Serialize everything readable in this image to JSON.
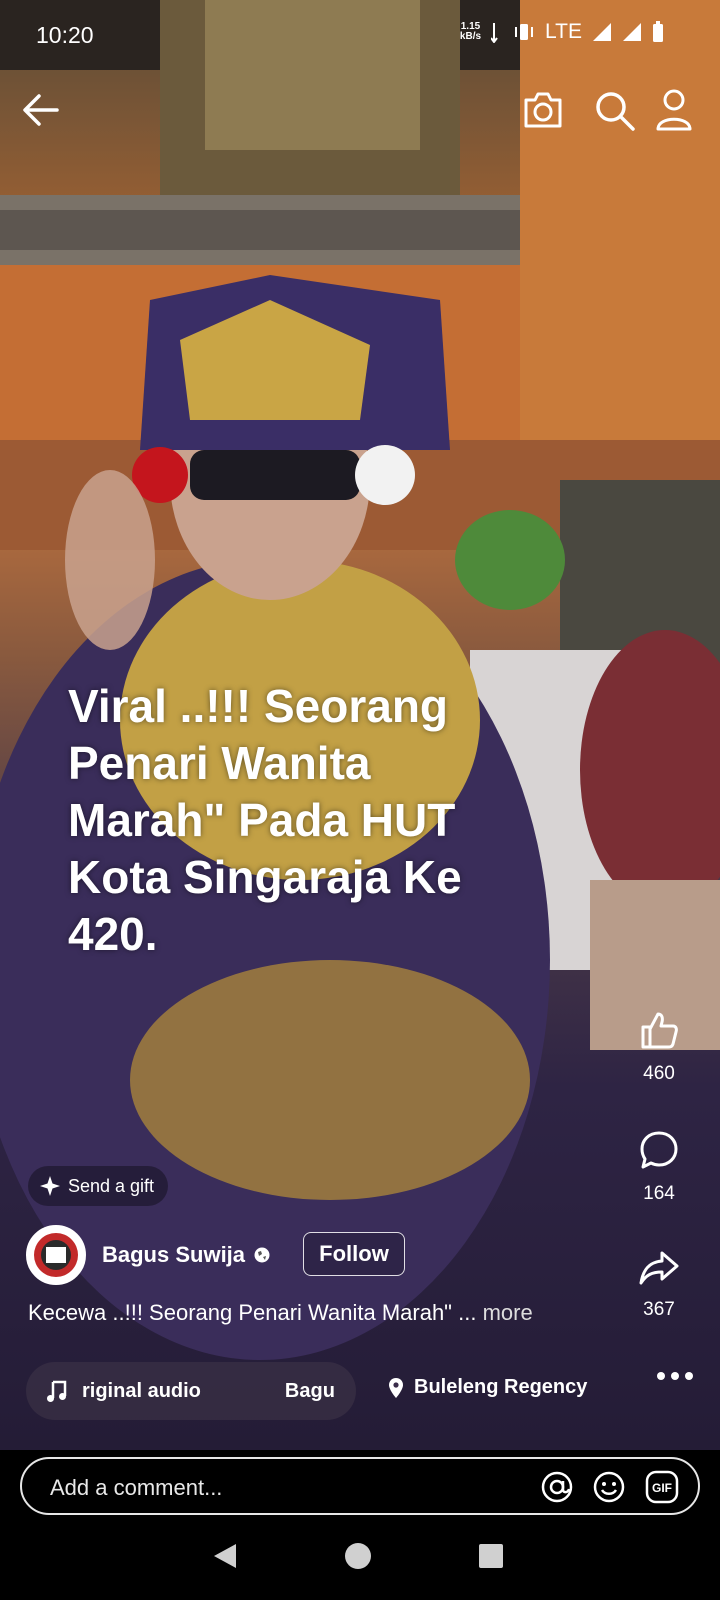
{
  "status_bar": {
    "time": "10:20",
    "net_speed_value": "1.15",
    "net_speed_unit": "kB/s",
    "network": "LTE"
  },
  "top_bar": {
    "back_icon": "arrow-left-icon",
    "camera_icon": "camera-icon",
    "search_icon": "search-icon",
    "profile_icon": "person-icon"
  },
  "video": {
    "overlay_text": [
      "Viral ..!!! Seorang",
      "Penari Wanita",
      "Marah\" Pada HUT",
      "Kota Singaraja Ke",
      "420."
    ]
  },
  "actions": {
    "likes": "460",
    "comments": "164",
    "shares": "367"
  },
  "gift": {
    "label": "Send a gift"
  },
  "author": {
    "name": "Bagus Suwija",
    "follow_label": "Follow"
  },
  "caption": {
    "text": "Kecewa ..!!! Seorang Penari Wanita Marah\" ...",
    "more_label": "more"
  },
  "audio": {
    "label": "riginal audio",
    "artist": "Bagu"
  },
  "location": {
    "label": "Buleleng Regency"
  },
  "comment": {
    "placeholder": "Add a comment..."
  },
  "colors": {
    "background": "#000000",
    "text": "#ffffff"
  }
}
